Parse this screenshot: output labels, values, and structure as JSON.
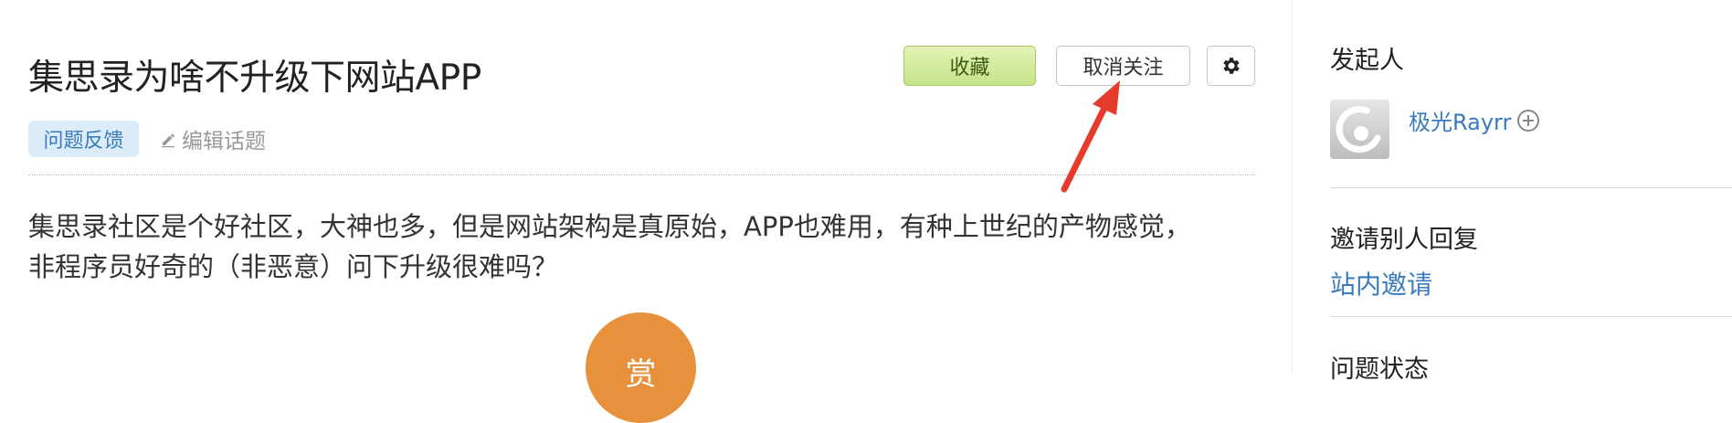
{
  "question": {
    "title": "集思录为啥不升级下网站APP",
    "tag": "问题反馈",
    "edit_topic_label": "编辑话题",
    "body_line1": "集思录社区是个好社区，大神也多，但是网站架构是真原始，APP也难用，有种上世纪的产物感觉，",
    "body_line2": "非程序员好奇的（非恶意）问下升级很难吗？",
    "reward_label": "赏"
  },
  "actions": {
    "favorite_label": "收藏",
    "unfollow_label": "取消关注",
    "settings_icon": "gear-icon"
  },
  "sidebar": {
    "initiator_heading": "发起人",
    "initiator_name": "极光Rayrr",
    "invite_heading": "邀请别人回复",
    "invite_link": "站内邀请",
    "status_heading": "问题状态"
  },
  "annotation": {
    "arrow_color": "#e53b2c"
  }
}
